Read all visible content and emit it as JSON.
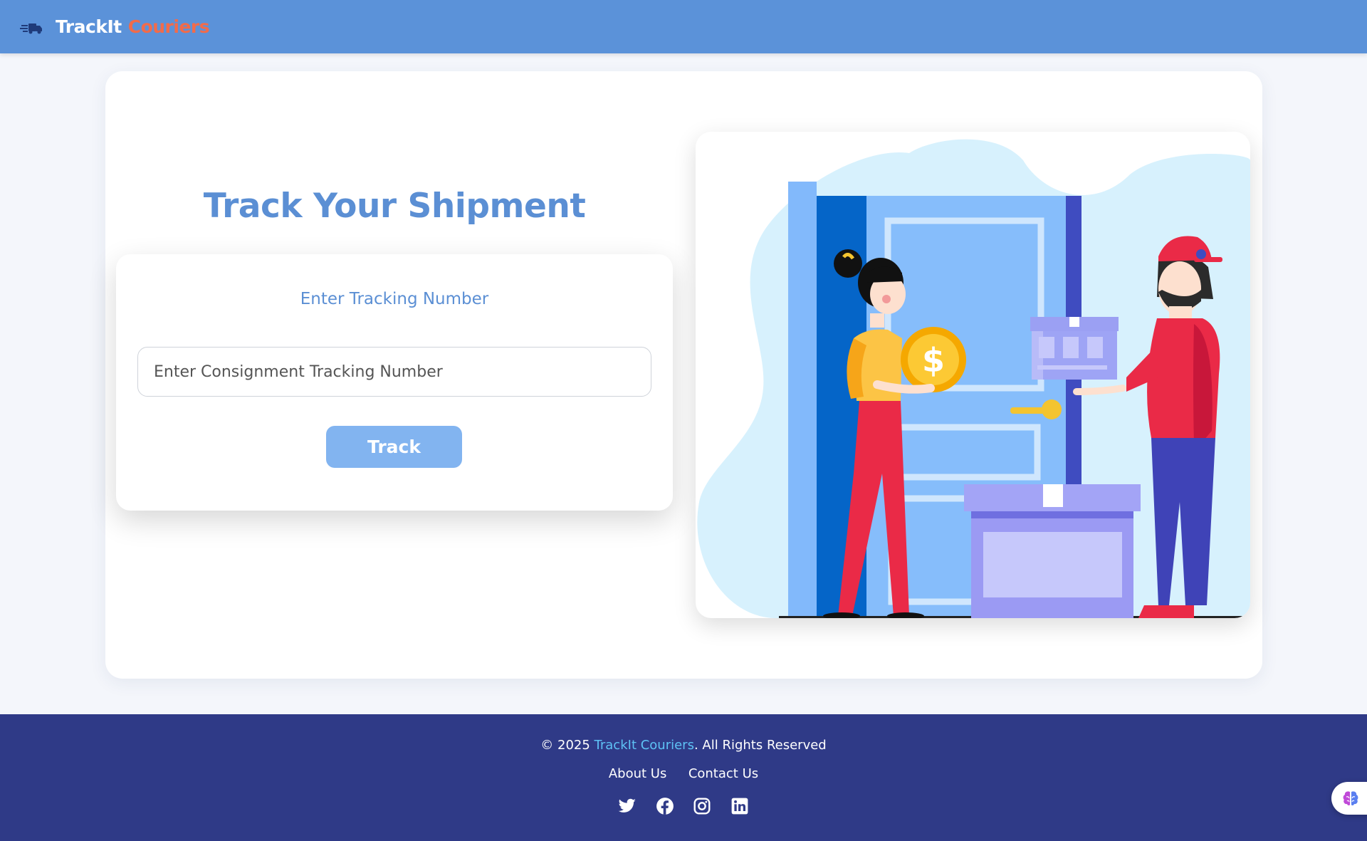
{
  "navbar": {
    "brand_name": "TrackIt",
    "brand_accent": "Couriers",
    "brand_icon": "fast-delivery-icon",
    "background_color": "#5b92d9",
    "accent_color": "#f26b4a"
  },
  "main": {
    "title": "Track Your Shipment",
    "form": {
      "label": "Enter Tracking Number",
      "input_placeholder": "Enter Consignment Tracking Number",
      "input_value": "",
      "button_label": "Track"
    },
    "illustration": "courier-delivery-illustration"
  },
  "footer": {
    "copyright_prefix": "© 2025 ",
    "copyright_brand": "TrackIt Couriers",
    "copyright_suffix": ". All Rights Reserved",
    "links": [
      "About Us",
      "Contact Us"
    ],
    "social_icons": [
      "twitter-icon",
      "facebook-icon",
      "instagram-icon",
      "linkedin-icon"
    ],
    "background_color": "#2f3a87",
    "highlight_color": "#5ec2f5"
  },
  "floating_badge": {
    "icon": "brain-icon"
  }
}
